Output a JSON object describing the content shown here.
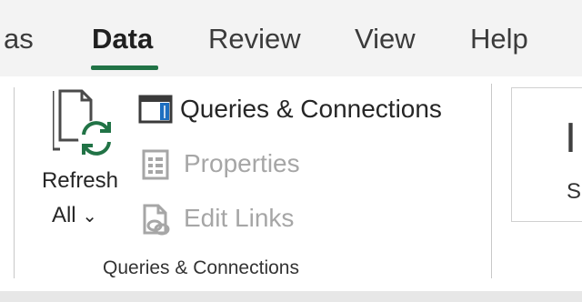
{
  "tabs": [
    "as",
    "Data",
    "Review",
    "View",
    "Help"
  ],
  "active_tab": "Data",
  "accent_color": "#217346",
  "group": {
    "label": "Queries & Connections",
    "refresh_all": {
      "line1": "Refresh",
      "line2": "All",
      "chevron": "⌄",
      "icon": "refresh-all-icon"
    },
    "queries_connections": {
      "label": "Queries & Connections",
      "icon": "queries-panel-icon",
      "enabled": true
    },
    "properties": {
      "label": "Properties",
      "icon": "properties-icon",
      "enabled": false
    },
    "edit_links": {
      "label": "Edit Links",
      "icon": "edit-links-icon",
      "enabled": false
    }
  },
  "next_group": {
    "label_partial": "S",
    "glyph": "Ⅰ"
  }
}
